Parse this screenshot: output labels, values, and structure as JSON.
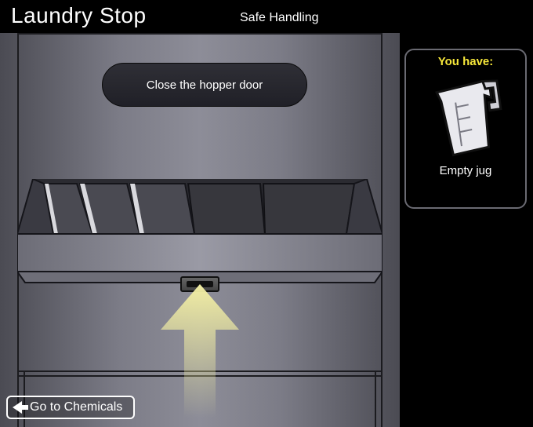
{
  "header": {
    "title": "Laundry Stop",
    "subtitle": "Safe Handling"
  },
  "instruction": "Close the hopper door",
  "inventory": {
    "heading": "You have:",
    "item_label": "Empty jug"
  },
  "nav": {
    "back_label": "Go to Chemicals"
  }
}
